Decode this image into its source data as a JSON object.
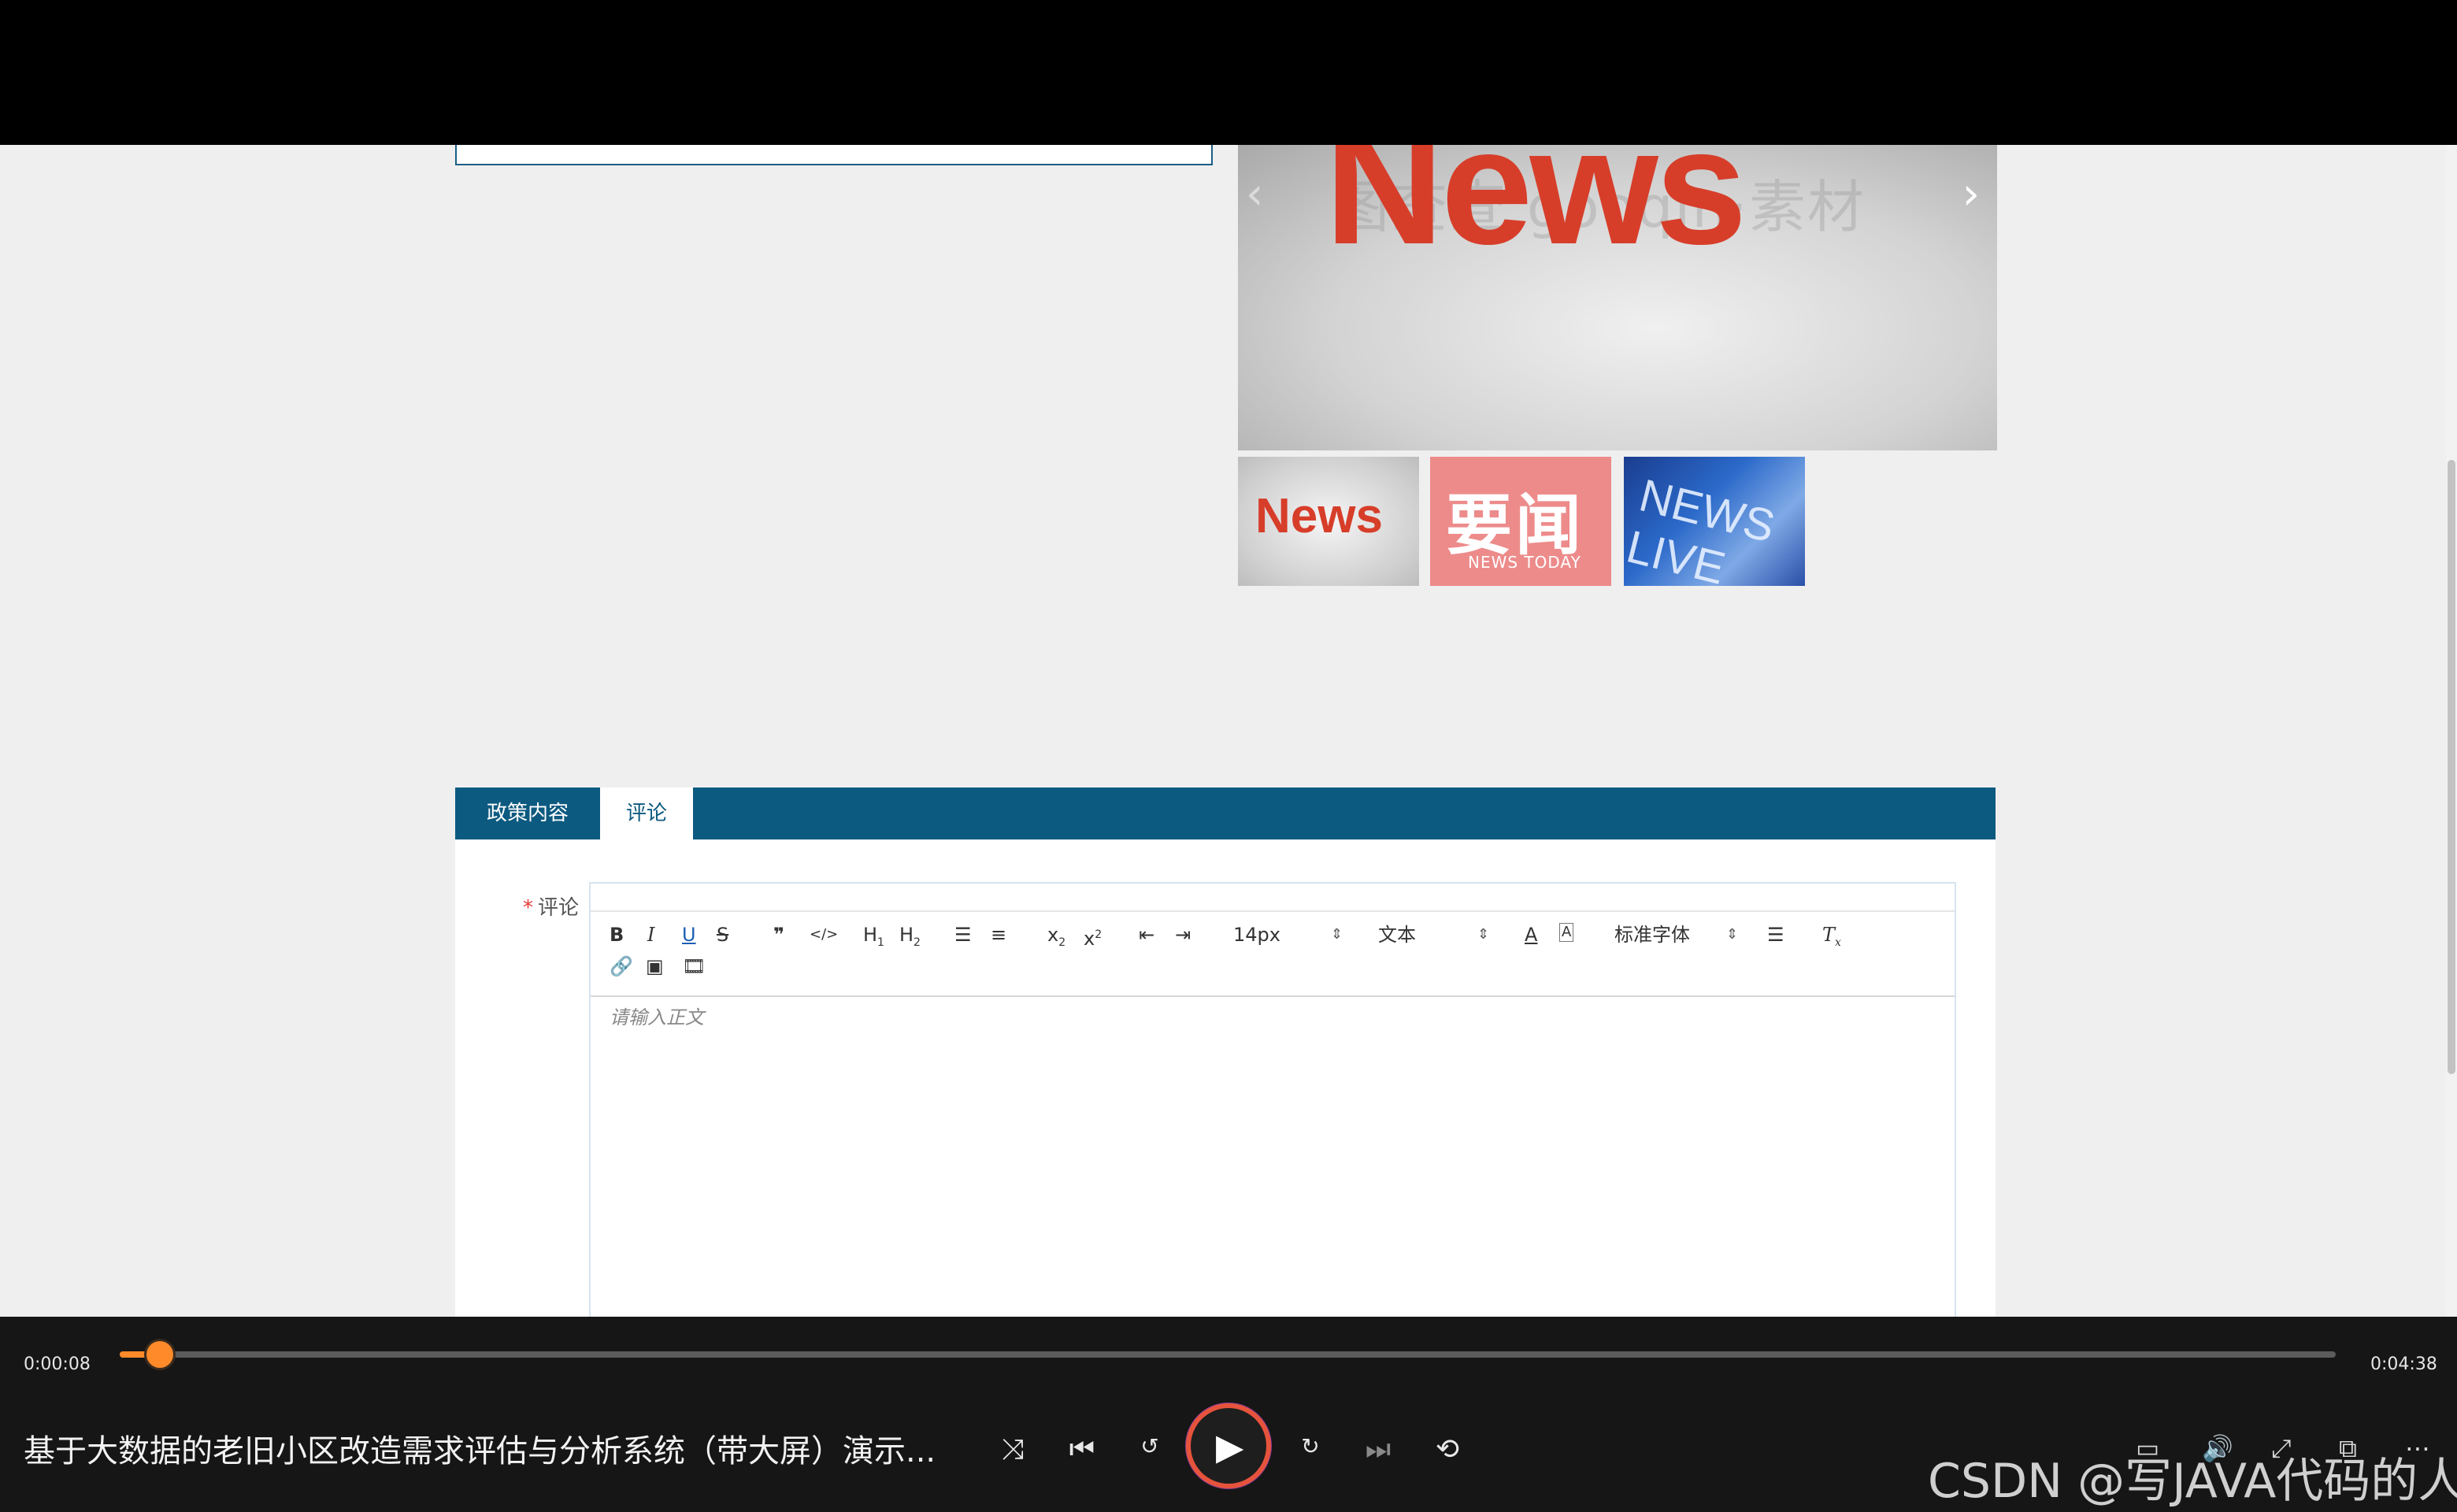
{
  "page": {
    "hero": {
      "headline": "News",
      "watermark_text": "图查查 gooqin·素材",
      "prev_icon": "chevron-left-icon",
      "next_icon": "chevron-right-icon"
    },
    "thumbnails": [
      {
        "text": "News"
      },
      {
        "text": "要闻",
        "subtext": "NEWS TODAY"
      },
      {
        "text": "NEWS LIVE"
      }
    ],
    "tabs": [
      {
        "label": "政策内容",
        "active": false
      },
      {
        "label": "评论",
        "active": true
      }
    ],
    "comment_form": {
      "required_mark": "*",
      "label": "评论",
      "editor_placeholder": "请输入正文",
      "toolbar": {
        "font_size": "14px",
        "block_format": "文本",
        "font_family": "标准字体"
      }
    }
  },
  "player": {
    "current_time": "0:00:08",
    "total_time": "0:04:38",
    "progress_fraction": 0.018,
    "title": "基于大数据的老旧小区改造需求评估与分析系统（带大屏）演示...",
    "watermark": "CSDN @写JAVA代码的人",
    "colors": {
      "accent": "#ff8a2a",
      "primary": "#0d5a80"
    }
  }
}
